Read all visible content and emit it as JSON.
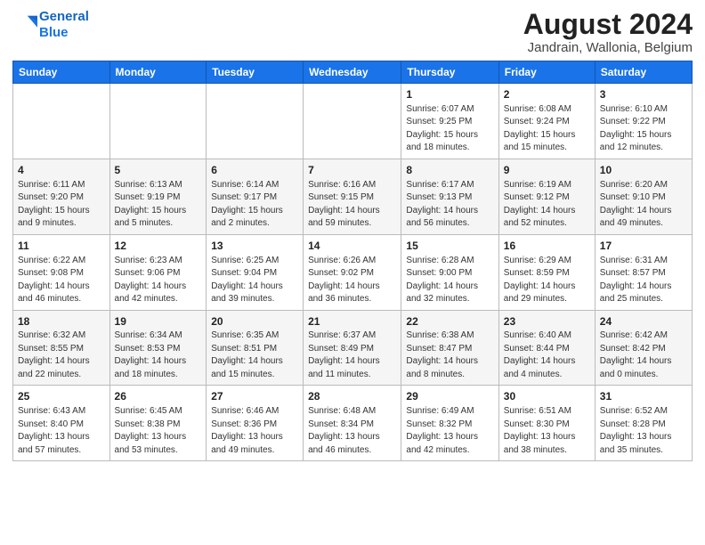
{
  "header": {
    "logo_line1": "General",
    "logo_line2": "Blue",
    "title": "August 2024",
    "subtitle": "Jandrain, Wallonia, Belgium"
  },
  "weekdays": [
    "Sunday",
    "Monday",
    "Tuesday",
    "Wednesday",
    "Thursday",
    "Friday",
    "Saturday"
  ],
  "weeks": [
    [
      {
        "day": "",
        "info": ""
      },
      {
        "day": "",
        "info": ""
      },
      {
        "day": "",
        "info": ""
      },
      {
        "day": "",
        "info": ""
      },
      {
        "day": "1",
        "info": "Sunrise: 6:07 AM\nSunset: 9:25 PM\nDaylight: 15 hours\nand 18 minutes."
      },
      {
        "day": "2",
        "info": "Sunrise: 6:08 AM\nSunset: 9:24 PM\nDaylight: 15 hours\nand 15 minutes."
      },
      {
        "day": "3",
        "info": "Sunrise: 6:10 AM\nSunset: 9:22 PM\nDaylight: 15 hours\nand 12 minutes."
      }
    ],
    [
      {
        "day": "4",
        "info": "Sunrise: 6:11 AM\nSunset: 9:20 PM\nDaylight: 15 hours\nand 9 minutes."
      },
      {
        "day": "5",
        "info": "Sunrise: 6:13 AM\nSunset: 9:19 PM\nDaylight: 15 hours\nand 5 minutes."
      },
      {
        "day": "6",
        "info": "Sunrise: 6:14 AM\nSunset: 9:17 PM\nDaylight: 15 hours\nand 2 minutes."
      },
      {
        "day": "7",
        "info": "Sunrise: 6:16 AM\nSunset: 9:15 PM\nDaylight: 14 hours\nand 59 minutes."
      },
      {
        "day": "8",
        "info": "Sunrise: 6:17 AM\nSunset: 9:13 PM\nDaylight: 14 hours\nand 56 minutes."
      },
      {
        "day": "9",
        "info": "Sunrise: 6:19 AM\nSunset: 9:12 PM\nDaylight: 14 hours\nand 52 minutes."
      },
      {
        "day": "10",
        "info": "Sunrise: 6:20 AM\nSunset: 9:10 PM\nDaylight: 14 hours\nand 49 minutes."
      }
    ],
    [
      {
        "day": "11",
        "info": "Sunrise: 6:22 AM\nSunset: 9:08 PM\nDaylight: 14 hours\nand 46 minutes."
      },
      {
        "day": "12",
        "info": "Sunrise: 6:23 AM\nSunset: 9:06 PM\nDaylight: 14 hours\nand 42 minutes."
      },
      {
        "day": "13",
        "info": "Sunrise: 6:25 AM\nSunset: 9:04 PM\nDaylight: 14 hours\nand 39 minutes."
      },
      {
        "day": "14",
        "info": "Sunrise: 6:26 AM\nSunset: 9:02 PM\nDaylight: 14 hours\nand 36 minutes."
      },
      {
        "day": "15",
        "info": "Sunrise: 6:28 AM\nSunset: 9:00 PM\nDaylight: 14 hours\nand 32 minutes."
      },
      {
        "day": "16",
        "info": "Sunrise: 6:29 AM\nSunset: 8:59 PM\nDaylight: 14 hours\nand 29 minutes."
      },
      {
        "day": "17",
        "info": "Sunrise: 6:31 AM\nSunset: 8:57 PM\nDaylight: 14 hours\nand 25 minutes."
      }
    ],
    [
      {
        "day": "18",
        "info": "Sunrise: 6:32 AM\nSunset: 8:55 PM\nDaylight: 14 hours\nand 22 minutes."
      },
      {
        "day": "19",
        "info": "Sunrise: 6:34 AM\nSunset: 8:53 PM\nDaylight: 14 hours\nand 18 minutes."
      },
      {
        "day": "20",
        "info": "Sunrise: 6:35 AM\nSunset: 8:51 PM\nDaylight: 14 hours\nand 15 minutes."
      },
      {
        "day": "21",
        "info": "Sunrise: 6:37 AM\nSunset: 8:49 PM\nDaylight: 14 hours\nand 11 minutes."
      },
      {
        "day": "22",
        "info": "Sunrise: 6:38 AM\nSunset: 8:47 PM\nDaylight: 14 hours\nand 8 minutes."
      },
      {
        "day": "23",
        "info": "Sunrise: 6:40 AM\nSunset: 8:44 PM\nDaylight: 14 hours\nand 4 minutes."
      },
      {
        "day": "24",
        "info": "Sunrise: 6:42 AM\nSunset: 8:42 PM\nDaylight: 14 hours\nand 0 minutes."
      }
    ],
    [
      {
        "day": "25",
        "info": "Sunrise: 6:43 AM\nSunset: 8:40 PM\nDaylight: 13 hours\nand 57 minutes."
      },
      {
        "day": "26",
        "info": "Sunrise: 6:45 AM\nSunset: 8:38 PM\nDaylight: 13 hours\nand 53 minutes."
      },
      {
        "day": "27",
        "info": "Sunrise: 6:46 AM\nSunset: 8:36 PM\nDaylight: 13 hours\nand 49 minutes."
      },
      {
        "day": "28",
        "info": "Sunrise: 6:48 AM\nSunset: 8:34 PM\nDaylight: 13 hours\nand 46 minutes."
      },
      {
        "day": "29",
        "info": "Sunrise: 6:49 AM\nSunset: 8:32 PM\nDaylight: 13 hours\nand 42 minutes."
      },
      {
        "day": "30",
        "info": "Sunrise: 6:51 AM\nSunset: 8:30 PM\nDaylight: 13 hours\nand 38 minutes."
      },
      {
        "day": "31",
        "info": "Sunrise: 6:52 AM\nSunset: 8:28 PM\nDaylight: 13 hours\nand 35 minutes."
      }
    ]
  ]
}
